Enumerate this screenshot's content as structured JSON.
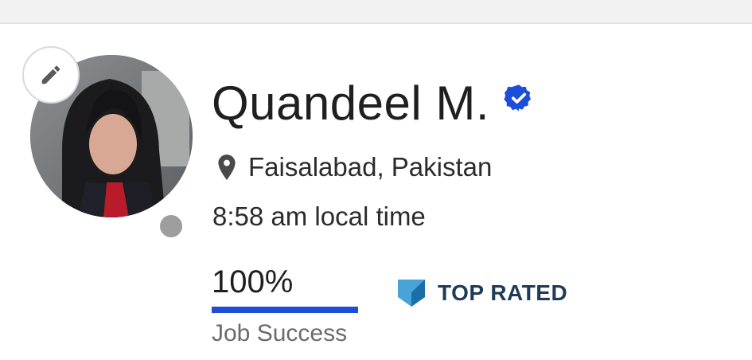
{
  "profile": {
    "name": "Quandeel M.",
    "location": "Faisalabad, Pakistan",
    "local_time": "8:58 am local time"
  },
  "job_success": {
    "value_text": "100%",
    "percent": 100,
    "label": "Job Success"
  },
  "badge": {
    "label": "TOP RATED"
  },
  "icons": {
    "edit": "pencil-icon",
    "verified": "verified-badge-icon",
    "location": "map-pin-icon",
    "status": "offline-status-dot",
    "top_rated": "top-rated-shield-icon"
  },
  "colors": {
    "accent_blue": "#1d4ed8",
    "badge_blue": "#4aa3d8",
    "status_grey": "#9e9e9e"
  }
}
